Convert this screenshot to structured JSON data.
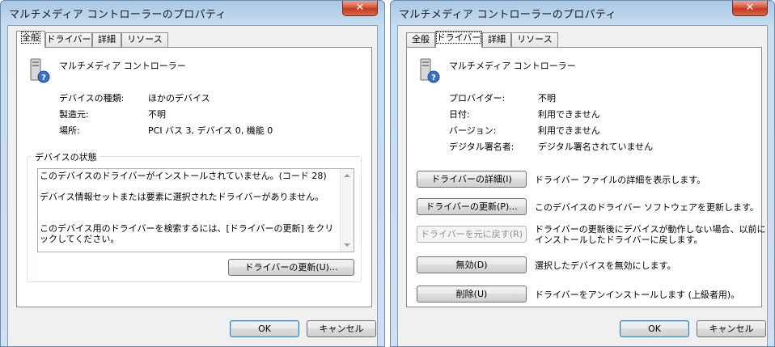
{
  "left_window": {
    "title": "マルチメディア コントローラーのプロパティ",
    "close_glyph": "✕",
    "tabs": [
      "全般",
      "ドライバー",
      "詳細",
      "リソース"
    ],
    "active_tab": "全般",
    "device_name": "マルチメディア コントローラー",
    "device_icon": "unknown-device-icon",
    "properties": [
      {
        "label": "デバイスの種類:",
        "value": "ほかのデバイス"
      },
      {
        "label": "製造元:",
        "value": "不明"
      },
      {
        "label": "場所:",
        "value": "PCI バス 3, デバイス 0, 機能 0"
      }
    ],
    "status_group_label": "デバイスの状態",
    "status_text": "このデバイスのドライバーがインストールされていません。(コード 28)\n\nデバイス情報セットまたは要素に選択されたドライバーがありません。\n\n\nこのデバイス用のドライバーを検索するには、[ドライバーの更新] をクリックしてください。",
    "update_driver_button": "ドライバーの更新(U)...",
    "ok_button": "OK",
    "cancel_button": "キャンセル"
  },
  "right_window": {
    "title": "マルチメディア コントローラーのプロパティ",
    "close_glyph": "✕",
    "tabs": [
      "全般",
      "ドライバー",
      "詳細",
      "リソース"
    ],
    "active_tab": "ドライバー",
    "device_name": "マルチメディア コントローラー",
    "device_icon": "unknown-device-icon",
    "properties": [
      {
        "label": "プロバイダー:",
        "value": "不明"
      },
      {
        "label": "日付:",
        "value": "利用できません"
      },
      {
        "label": "バージョン:",
        "value": "利用できません"
      },
      {
        "label": "デジタル署名者:",
        "value": "デジタル署名されていません"
      }
    ],
    "actions": [
      {
        "button": "ドライバーの詳細(I)",
        "description": "ドライバー ファイルの詳細を表示します。",
        "enabled": true
      },
      {
        "button": "ドライバーの更新(P)...",
        "description": "このデバイスのドライバー ソフトウェアを更新します。",
        "enabled": true
      },
      {
        "button": "ドライバーを元に戻す(R)",
        "description": "ドライバーの更新後にデバイスが動作しない場合、以前に\nインストールしたドライバーに戻します。",
        "enabled": false
      },
      {
        "button": "無効(D)",
        "description": "選択したデバイスを無効にします。",
        "enabled": true
      },
      {
        "button": "削除(U)",
        "description": "ドライバーをアンインストールします (上級者用)。",
        "enabled": true
      }
    ],
    "ok_button": "OK",
    "cancel_button": "キャンセル"
  },
  "colors": {
    "titlebar": "#b4cfe9",
    "close_button": "#c9452a",
    "dialog_background": "#f0f0f0",
    "default_button_border": "#3c7fb1"
  }
}
